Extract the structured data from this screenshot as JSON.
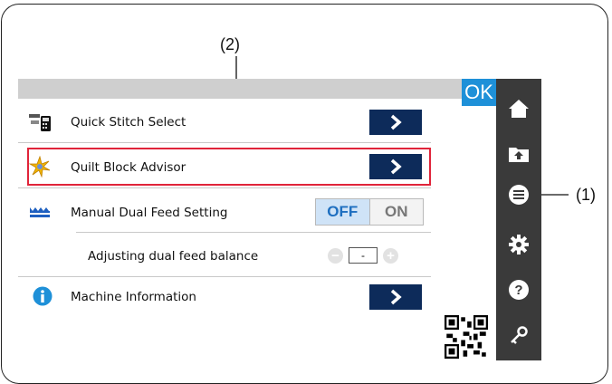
{
  "callouts": {
    "top": "(2)",
    "right": "(1)"
  },
  "header": {
    "ok_label": "OK"
  },
  "menu": {
    "quick_stitch_select": "Quick Stitch Select",
    "quilt_block_advisor": "Quilt Block Advisor",
    "manual_dual_feed": "Manual Dual Feed Setting",
    "dual_feed_balance": "Adjusting dual feed balance",
    "machine_information": "Machine Information",
    "toggle_off": "OFF",
    "toggle_on": "ON",
    "balance_value": "-"
  },
  "sidebar": {
    "items": [
      "home-icon",
      "folder-icon",
      "menu-icon",
      "gear-icon",
      "help-icon",
      "key-icon"
    ]
  },
  "colors": {
    "accent": "#1e90d8",
    "go_button": "#0d2b5a",
    "highlight": "#e0243a",
    "sidebar": "#3a3a3a"
  }
}
